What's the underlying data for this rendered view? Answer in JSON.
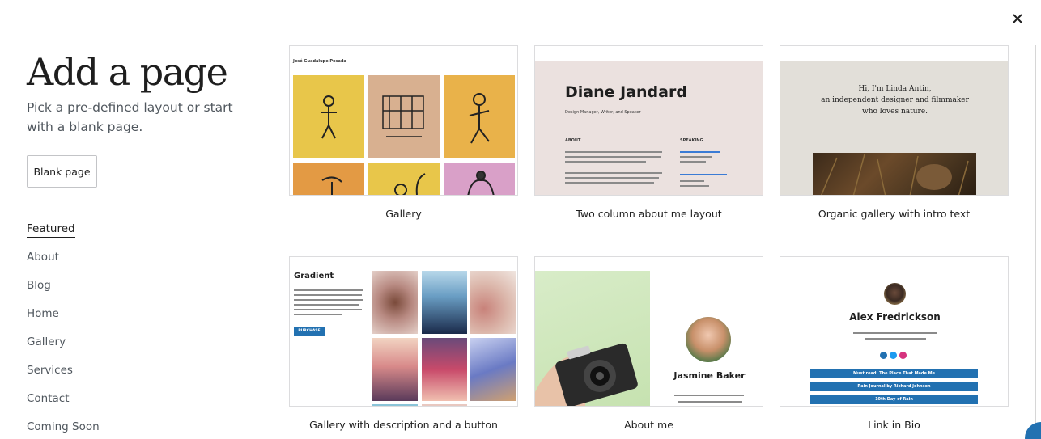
{
  "modal": {
    "title": "Add a page",
    "subtitle": "Pick a pre-defined layout or start with a blank page.",
    "blank_button": "Blank page",
    "close_icon": "close-icon"
  },
  "categories": [
    {
      "label": "Featured",
      "active": true
    },
    {
      "label": "About",
      "active": false
    },
    {
      "label": "Blog",
      "active": false
    },
    {
      "label": "Home",
      "active": false
    },
    {
      "label": "Gallery",
      "active": false
    },
    {
      "label": "Services",
      "active": false
    },
    {
      "label": "Contact",
      "active": false
    },
    {
      "label": "Coming Soon",
      "active": false
    }
  ],
  "layouts": [
    {
      "caption": "Gallery",
      "heading": "José Guadalupe Posada"
    },
    {
      "caption": "Two column about me layout",
      "heading": "Diane Jandard",
      "sub": "Design Manager, Writer, and Speaker",
      "col1": "ABOUT",
      "col2": "SPEAKING"
    },
    {
      "caption": "Organic gallery with intro text",
      "line1": "Hi, I'm Linda Antin,",
      "line2": "an independent designer and filmmaker",
      "line3": "who loves nature."
    },
    {
      "caption": "Gallery with description and a button",
      "heading": "Gradient",
      "button": "PURCHASE"
    },
    {
      "caption": "About me",
      "name": "Jasmine Baker"
    },
    {
      "caption": "Link in Bio",
      "name": "Alex Fredrickson",
      "links": [
        "Must read: The Place That Made Me",
        "Rain Journal by Richard Johnson",
        "10th Day of Rain"
      ]
    }
  ]
}
